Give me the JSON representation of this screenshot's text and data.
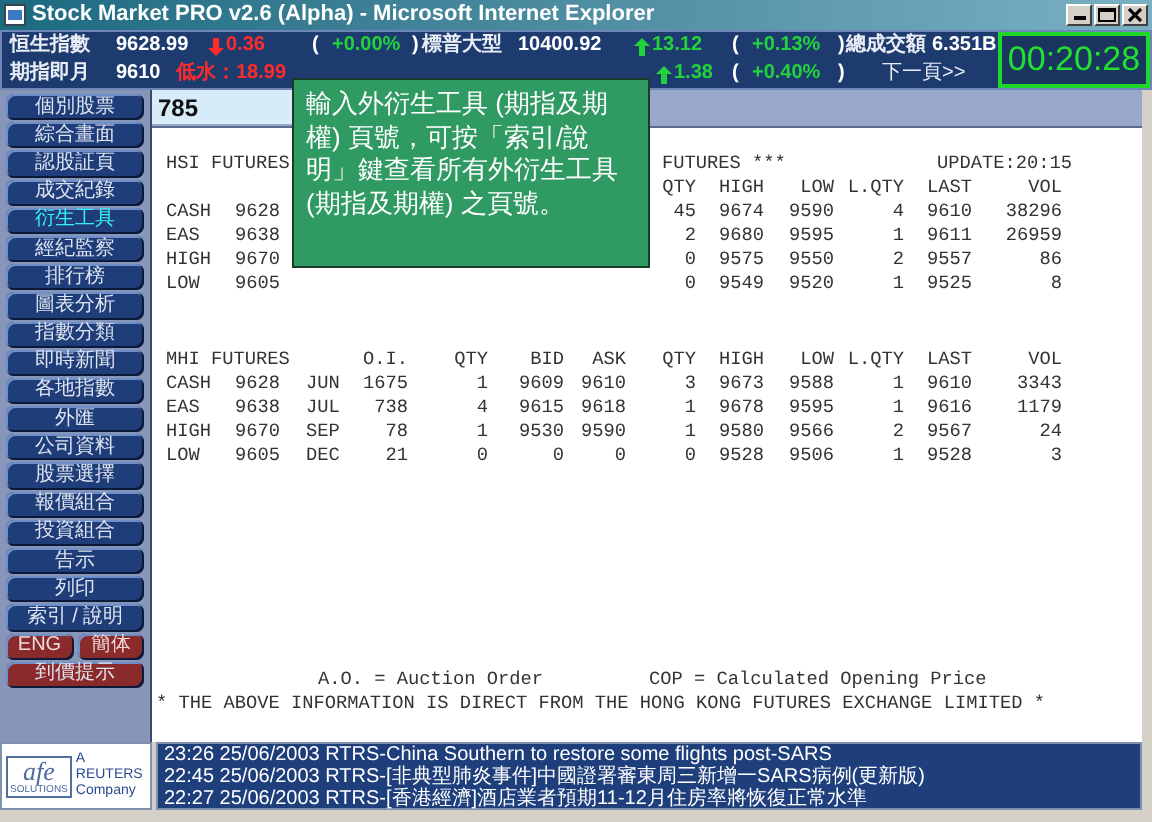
{
  "window": {
    "title": "Stock Market PRO v2.6 (Alpha) - Microsoft Internet Explorer"
  },
  "ticker": [
    [
      {
        "text": "恒生指數",
        "kind": "plain",
        "color": "#e8ecf4"
      },
      {
        "text": "9628.99",
        "kind": "plain",
        "color": "#ffffff"
      },
      {
        "text": "0.36",
        "kind": "fall",
        "color": "#ff2a2a"
      },
      {
        "text": "(",
        "kind": "plain",
        "color": "#ffffff"
      },
      {
        "text": "+0.00%",
        "kind": "plain",
        "color": "#22d23a"
      },
      {
        "text": ")",
        "kind": "plain",
        "color": "#ffffff"
      },
      {
        "text": "標普大型",
        "kind": "plain",
        "color": "#e8ecf4"
      },
      {
        "text": "10400.92",
        "kind": "plain",
        "color": "#ffffff"
      },
      {
        "text": "13.12",
        "kind": "rise",
        "color": "#22d23a"
      },
      {
        "text": "(",
        "kind": "plain",
        "color": "#ffffff"
      },
      {
        "text": "+0.13%",
        "kind": "plain",
        "color": "#22d23a"
      },
      {
        "text": ")",
        "kind": "plain",
        "color": "#ffffff"
      },
      {
        "text": "總成交額",
        "kind": "plain",
        "color": "#e8ecf4"
      },
      {
        "text": "6.351B",
        "kind": "plain",
        "color": "#ffffff"
      }
    ],
    [
      {
        "text": "期指即月",
        "kind": "plain",
        "color": "#e8ecf4"
      },
      {
        "text": "9610",
        "kind": "plain",
        "color": "#ffffff"
      },
      {
        "text": "低水：18.99",
        "kind": "plain",
        "color": "#ff2a2a"
      },
      {
        "text": "1.38",
        "kind": "rise",
        "color": "#22d23a"
      },
      {
        "text": "(",
        "kind": "plain",
        "color": "#ffffff"
      },
      {
        "text": "+0.40%",
        "kind": "plain",
        "color": "#22d23a"
      },
      {
        "text": ")",
        "kind": "plain",
        "color": "#ffffff"
      },
      {
        "text": "下一頁",
        "kind": "link",
        "color": "#e8ecf4"
      },
      {
        "text": ">>",
        "kind": "link",
        "color": "#e8ecf4"
      }
    ]
  ],
  "clock": "00:20:28",
  "sidebar": {
    "items": [
      {
        "kind": "nav",
        "label": "個別股票",
        "selected": false
      },
      {
        "kind": "nav",
        "label": "綜合畫面",
        "selected": false
      },
      {
        "kind": "nav",
        "label": "認股証頁",
        "selected": false
      },
      {
        "kind": "nav",
        "label": "成交紀錄",
        "selected": false
      },
      {
        "kind": "nav",
        "label": "衍生工具",
        "selected": true
      },
      {
        "kind": "nav",
        "label": "經紀監察",
        "selected": false
      },
      {
        "kind": "nav",
        "label": "排行榜",
        "selected": false
      },
      {
        "kind": "nav",
        "label": "圖表分析",
        "selected": false
      },
      {
        "kind": "nav",
        "label": "指數分類",
        "selected": false
      },
      {
        "kind": "nav",
        "label": "即時新聞",
        "selected": false
      },
      {
        "kind": "nav",
        "label": "各地指數",
        "selected": false
      },
      {
        "kind": "nav",
        "label": "外匯",
        "selected": false
      },
      {
        "kind": "nav",
        "label": "公司資料",
        "selected": false
      },
      {
        "kind": "nav",
        "label": "股票選擇",
        "selected": false
      },
      {
        "kind": "nav",
        "label": "報價組合",
        "selected": false
      },
      {
        "kind": "nav",
        "label": "投資組合",
        "selected": false
      },
      {
        "kind": "nav",
        "label": "告示",
        "selected": false
      },
      {
        "kind": "nav",
        "label": "列印",
        "selected": false
      },
      {
        "kind": "nav",
        "label": "索引 / 說明",
        "selected": false
      },
      {
        "kind": "lang",
        "labels": [
          "ENG",
          "簡体"
        ]
      },
      {
        "kind": "alert",
        "label": "到價提示",
        "selected": false
      }
    ]
  },
  "page_field": {
    "value": "785"
  },
  "callout": "輸入外衍生工具 (期指及期權) 頁號，可按「索引/說明」鍵查看所有外衍生工具 (期指及期權) 之頁號。",
  "hsi": {
    "title": "HSI FUTURES",
    "title_2": "FUTURES ***",
    "update": "UPDATE:20:15",
    "columns": [
      "QTY",
      "HIGH",
      "LOW",
      "L.QTY",
      "LAST",
      "VOL"
    ],
    "rows": [
      {
        "label": "CASH",
        "price": "9628",
        "cells": [
          "45",
          "9674",
          "9590",
          "4",
          "9610",
          "38296"
        ]
      },
      {
        "label": "EAS",
        "price": "9638",
        "cells": [
          "2",
          "9680",
          "9595",
          "1",
          "9611",
          "26959"
        ]
      },
      {
        "label": "HIGH",
        "price": "9670",
        "cells": [
          "0",
          "9575",
          "9550",
          "2",
          "9557",
          "86"
        ]
      },
      {
        "label": "LOW",
        "price": "9605",
        "cells": [
          "0",
          "9549",
          "9520",
          "1",
          "9525",
          "8"
        ]
      }
    ]
  },
  "mhi": {
    "title": "MHI FUTURES",
    "columns": [
      "O.I.",
      "QTY",
      "BID",
      "ASK",
      "QTY",
      "HIGH",
      "LOW",
      "L.QTY",
      "LAST",
      "VOL"
    ],
    "rows": [
      {
        "label": "CASH",
        "price": "9628",
        "month": "JUN",
        "cells": [
          "1675",
          "1",
          "9609",
          "9610",
          "3",
          "9673",
          "9588",
          "1",
          "9610",
          "3343"
        ]
      },
      {
        "label": "EAS",
        "price": "9638",
        "month": "JUL",
        "cells": [
          "738",
          "4",
          "9615",
          "9618",
          "1",
          "9678",
          "9595",
          "1",
          "9616",
          "1179"
        ]
      },
      {
        "label": "HIGH",
        "price": "9670",
        "month": "SEP",
        "cells": [
          "78",
          "1",
          "9530",
          "9590",
          "1",
          "9580",
          "9566",
          "2",
          "9567",
          "24"
        ]
      },
      {
        "label": "LOW",
        "price": "9605",
        "month": "DEC",
        "cells": [
          "21",
          "0",
          "0",
          "0",
          "0",
          "9528",
          "9506",
          "1",
          "9528",
          "3"
        ]
      }
    ]
  },
  "notes": [
    "A.O. = Auction Order",
    "COP = Calculated Opening Price"
  ],
  "disclaimer": "* THE ABOVE INFORMATION IS DIRECT FROM THE HONG KONG FUTURES EXCHANGE LIMITED *",
  "logo": {
    "brand": "afe",
    "sub": "SOLUTIONS",
    "tagline": [
      "A",
      "REUTERS",
      "Company"
    ]
  },
  "news": [
    "23:26 25/06/2003 RTRS-China Southern to restore some flights post-SARS",
    "22:45 25/06/2003 RTRS-[非典型肺炎事件]中國證署審東周三新增一SARS病例(更新版)",
    "22:27 25/06/2003 RTRS-[香港經濟]酒店業者預期11-12月住房率將恢復正常水準"
  ]
}
